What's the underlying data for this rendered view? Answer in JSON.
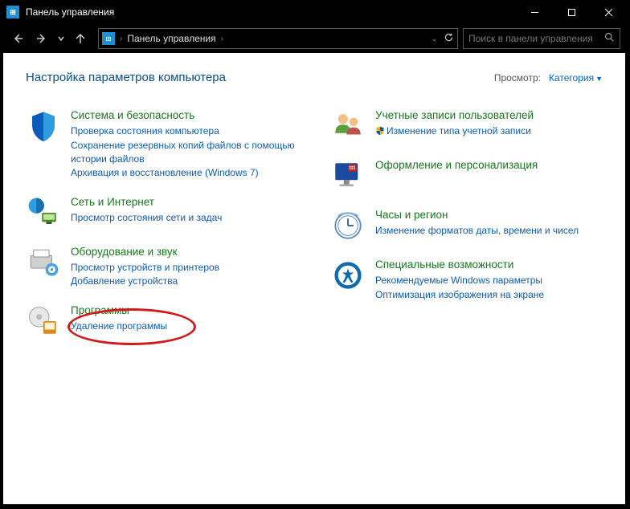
{
  "titlebar": {
    "title": "Панель управления"
  },
  "breadcrumb": {
    "location": "Панель управления"
  },
  "search": {
    "placeholder": "Поиск в панели управления"
  },
  "header": {
    "title": "Настройка параметров компьютера",
    "view_label": "Просмотр:",
    "view_value": "Категория"
  },
  "left": [
    {
      "title": "Система и безопасность",
      "links": [
        "Проверка состояния компьютера",
        "Сохранение резервных копий файлов с помощью истории файлов",
        "Архивация и восстановление (Windows 7)"
      ]
    },
    {
      "title": "Сеть и Интернет",
      "links": [
        "Просмотр состояния сети и задач"
      ]
    },
    {
      "title": "Оборудование и звук",
      "links": [
        "Просмотр устройств и принтеров",
        "Добавление устройства"
      ]
    },
    {
      "title": "Программы",
      "links": [
        "Удаление программы"
      ]
    }
  ],
  "right": [
    {
      "title": "Учетные записи пользователей",
      "links": [
        "Изменение типа учетной записи"
      ],
      "shield": [
        true
      ]
    },
    {
      "title": "Оформление и персонализация",
      "links": []
    },
    {
      "title": "Часы и регион",
      "links": [
        "Изменение форматов даты, времени и чисел"
      ]
    },
    {
      "title": "Специальные возможности",
      "links": [
        "Рекомендуемые Windows параметры",
        "Оптимизация изображения на экране"
      ]
    }
  ]
}
